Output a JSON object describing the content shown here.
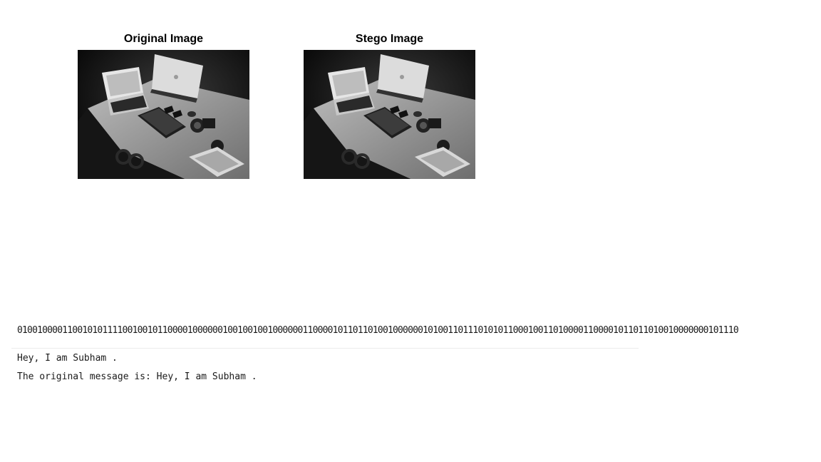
{
  "figures": {
    "original": {
      "title": "Original Image",
      "image": "grayscale-desk-laptops-photo"
    },
    "stego": {
      "title": "Stego Image",
      "image": "grayscale-desk-laptops-photo"
    }
  },
  "output": {
    "binary_line": "010010000110010101111001001011000010000001001001001000000110000101101101001000000101001101110101011000100110100001100001011011010010000000101110",
    "decoded_line": "Hey, I am Subham .",
    "result_line": "The original message is: Hey, I am Subham ."
  }
}
